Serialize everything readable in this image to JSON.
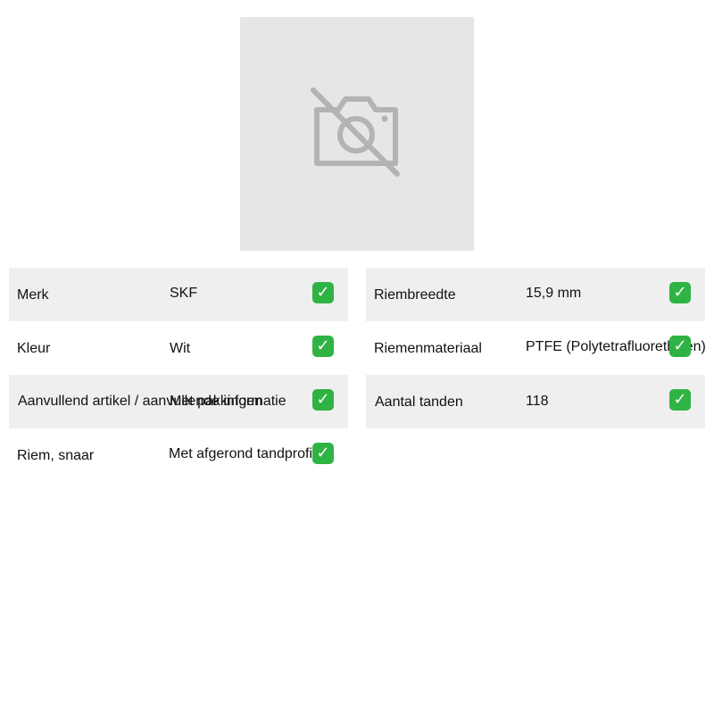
{
  "product_image": {
    "placeholder_icon": "no-image-camera-icon",
    "placeholder_bg": "#e6e6e6",
    "icon_color": "#b3b3b3"
  },
  "specs": {
    "left": [
      {
        "label": "Merk",
        "value": "SKF",
        "icon": "check-icon"
      },
      {
        "label": "Kleur",
        "value": "Wit",
        "icon": "check-icon"
      },
      {
        "label": "Aanvullend artikel / aanvullende informatie",
        "value": "Met pakkingen",
        "icon": "check-icon"
      },
      {
        "label": "Riem, snaar",
        "value": "Met afgerond tandprofiel",
        "icon": "check-icon"
      }
    ],
    "right": [
      {
        "label": "Riembreedte",
        "value": "15,9 mm",
        "icon": "check-icon"
      },
      {
        "label": "Riemenmateriaal",
        "value": "PTFE (Polytetrafluorethylen)",
        "icon": "check-icon"
      },
      {
        "label": "Aantal tanden",
        "value": "118",
        "icon": "check-icon"
      }
    ]
  },
  "check_glyph": "✓",
  "colors": {
    "row_shade": "#efefef",
    "check_green": "#2fb344"
  }
}
